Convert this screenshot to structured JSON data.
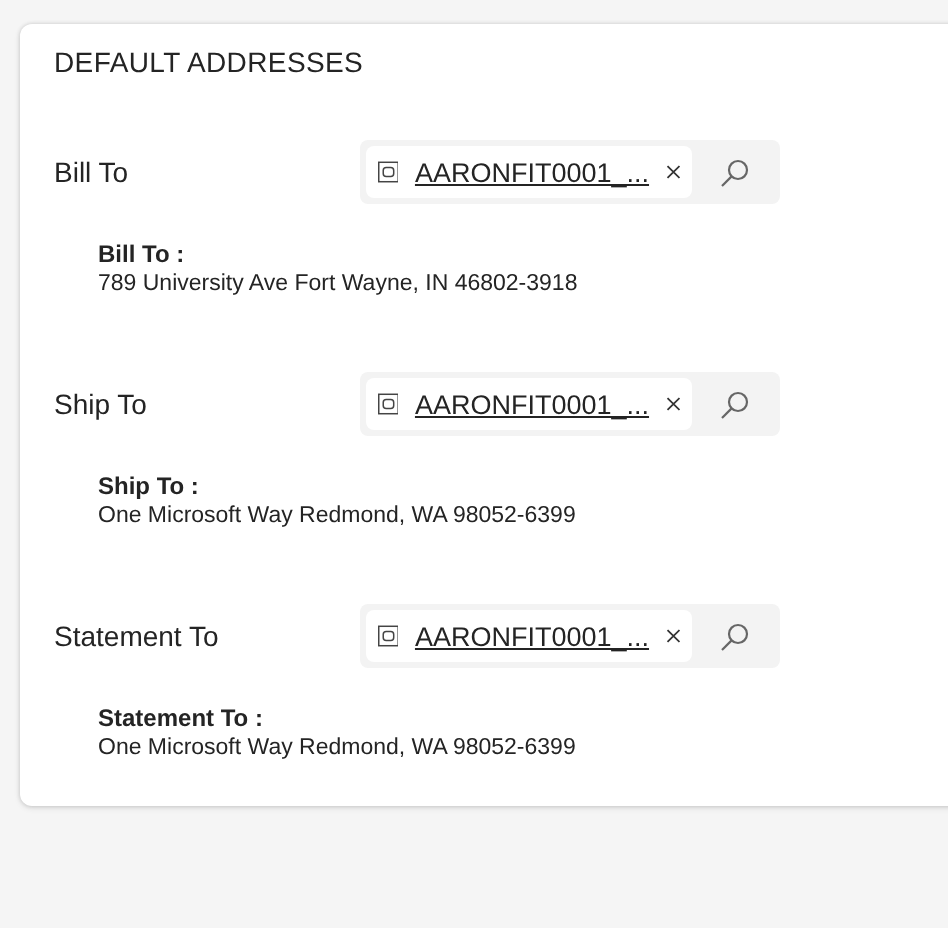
{
  "section": {
    "title": "DEFAULT ADDRESSES"
  },
  "addresses": [
    {
      "label": "Bill To",
      "value": "AARONFIT0001_...",
      "heading": "Bill To :",
      "address": "789 University Ave Fort Wayne, IN 46802-3918"
    },
    {
      "label": "Ship To",
      "value": "AARONFIT0001_...",
      "heading": "Ship To :",
      "address": "One Microsoft Way Redmond, WA 98052-6399"
    },
    {
      "label": "Statement To",
      "value": "AARONFIT0001_...",
      "heading": "Statement To :",
      "address": "One Microsoft Way Redmond, WA 98052-6399"
    }
  ]
}
